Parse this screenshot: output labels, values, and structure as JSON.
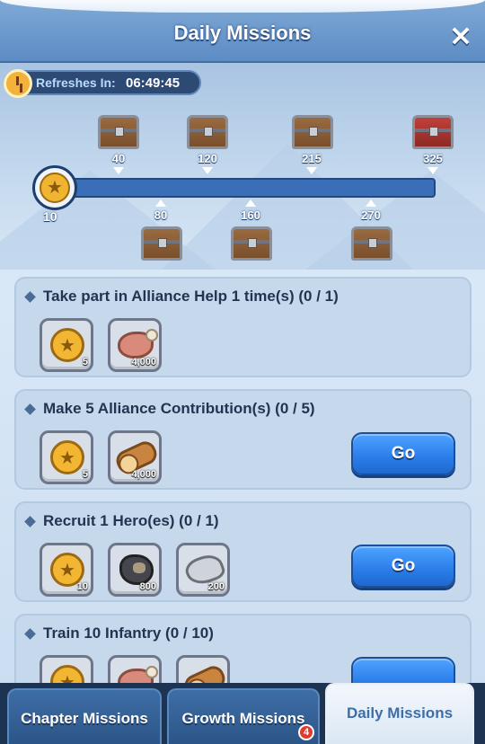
{
  "header": {
    "title": "Daily Missions",
    "close_icon": "×"
  },
  "refresh": {
    "label": "Refreshes In:",
    "time": "06:49:45"
  },
  "progress": {
    "current": "10",
    "fill_fraction": 0.03,
    "milestones_top": [
      "40",
      "120",
      "215",
      "325"
    ],
    "milestones_bottom": [
      "80",
      "160",
      "270"
    ]
  },
  "missions": [
    {
      "title": "Take part in Alliance Help 1 time(s) (0 / 1)",
      "rewards": [
        {
          "icon": "star-coin-icon",
          "qty": "5"
        },
        {
          "icon": "meat-icon",
          "qty": "4,000"
        }
      ]
    },
    {
      "title": "Make 5 Alliance Contribution(s) (0 / 5)",
      "rewards": [
        {
          "icon": "star-coin-icon",
          "qty": "5"
        },
        {
          "icon": "wood-icon",
          "qty": "4,000"
        }
      ],
      "button": "Go"
    },
    {
      "title": "Recruit 1 Hero(es) (0 / 1)",
      "rewards": [
        {
          "icon": "star-coin-icon",
          "qty": "10"
        },
        {
          "icon": "coal-icon",
          "qty": "800"
        },
        {
          "icon": "iron-icon",
          "qty": "200"
        }
      ],
      "button": "Go"
    },
    {
      "title": "Train 10 Infantry (0 / 10)"
    }
  ],
  "tabs": [
    {
      "label": "Chapter Missions"
    },
    {
      "label": "Growth Missions",
      "badge": "4"
    },
    {
      "label": "Daily Missions",
      "active": true
    }
  ]
}
